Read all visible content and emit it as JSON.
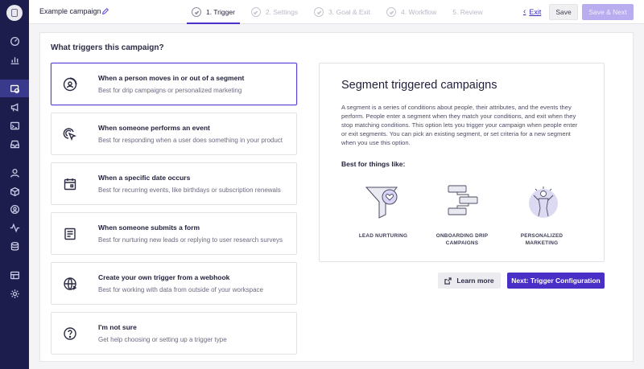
{
  "topbar": {
    "campaign_name": "Example campaign",
    "steps": [
      {
        "label": "1. Trigger",
        "active": true
      },
      {
        "label": "2. Settings",
        "active": false
      },
      {
        "label": "3. Goal & Exit",
        "active": false
      },
      {
        "label": "4. Workflow",
        "active": false
      },
      {
        "label": "5. Review",
        "active": false
      }
    ],
    "exit_label": "Exit",
    "save_label": "Save",
    "save_next_label": "Save & Next"
  },
  "sidebar": {
    "items": [
      {
        "icon": "dashboard-icon"
      },
      {
        "icon": "analytics-icon"
      },
      {
        "icon": "campaigns-icon",
        "active": true
      },
      {
        "icon": "broadcast-icon"
      },
      {
        "icon": "transactional-icon"
      },
      {
        "icon": "inbox-icon"
      },
      {
        "icon": "people-icon"
      },
      {
        "icon": "objects-icon"
      },
      {
        "icon": "segments-icon"
      },
      {
        "icon": "activity-icon"
      },
      {
        "icon": "data-icon"
      },
      {
        "icon": "content-icon"
      },
      {
        "icon": "settings-icon"
      }
    ]
  },
  "main": {
    "question": "What triggers this campaign?",
    "options": [
      {
        "title": "When a person moves in or out of a segment",
        "desc": "Best for drip campaigns or personalized marketing",
        "icon": "segment-icon",
        "selected": true
      },
      {
        "title": "When someone performs an event",
        "desc": "Best for responding when a user does something in your product",
        "icon": "event-cursor-icon",
        "selected": false
      },
      {
        "title": "When a specific date occurs",
        "desc": "Best for recurring events, like birthdays or subscription renewals",
        "icon": "calendar-icon",
        "selected": false
      },
      {
        "title": "When someone submits a form",
        "desc": "Best for nurturing new leads or replying to user research surveys",
        "icon": "form-icon",
        "selected": false
      },
      {
        "title": "Create your own trigger from a webhook",
        "desc": "Best for working with data from outside of your workspace",
        "icon": "webhook-icon",
        "selected": false
      },
      {
        "title": "I'm not sure",
        "desc": "Get help choosing or setting up a trigger type",
        "icon": "question-icon",
        "selected": false
      }
    ],
    "info": {
      "title": "Segment triggered campaigns",
      "body": "A segment is a series of conditions about people, their attributes, and the events they perform. People enter a segment when they match your conditions, and exit when they stop matching conditions. This option lets you trigger your campaign when people enter or exit segments. You can pick an existing segment, or set criteria for a new segment when you use this option.",
      "best_for": "Best for things like:",
      "use_cases": [
        {
          "label": "LEAD NURTURING",
          "icon": "funnel-heart-icon"
        },
        {
          "label": "ONBOARDING DRIP CAMPAIGNS",
          "icon": "flow-diagram-icon"
        },
        {
          "label": "PERSONALIZED MARKETING",
          "icon": "person-target-icon"
        }
      ]
    },
    "learn_more_label": "Learn more",
    "next_label": "Next: Trigger Configuration"
  },
  "colors": {
    "accent": "#4a2fc7",
    "sidebar_bg": "#1c1c4d",
    "save_next_disabled": "#b9acef"
  }
}
